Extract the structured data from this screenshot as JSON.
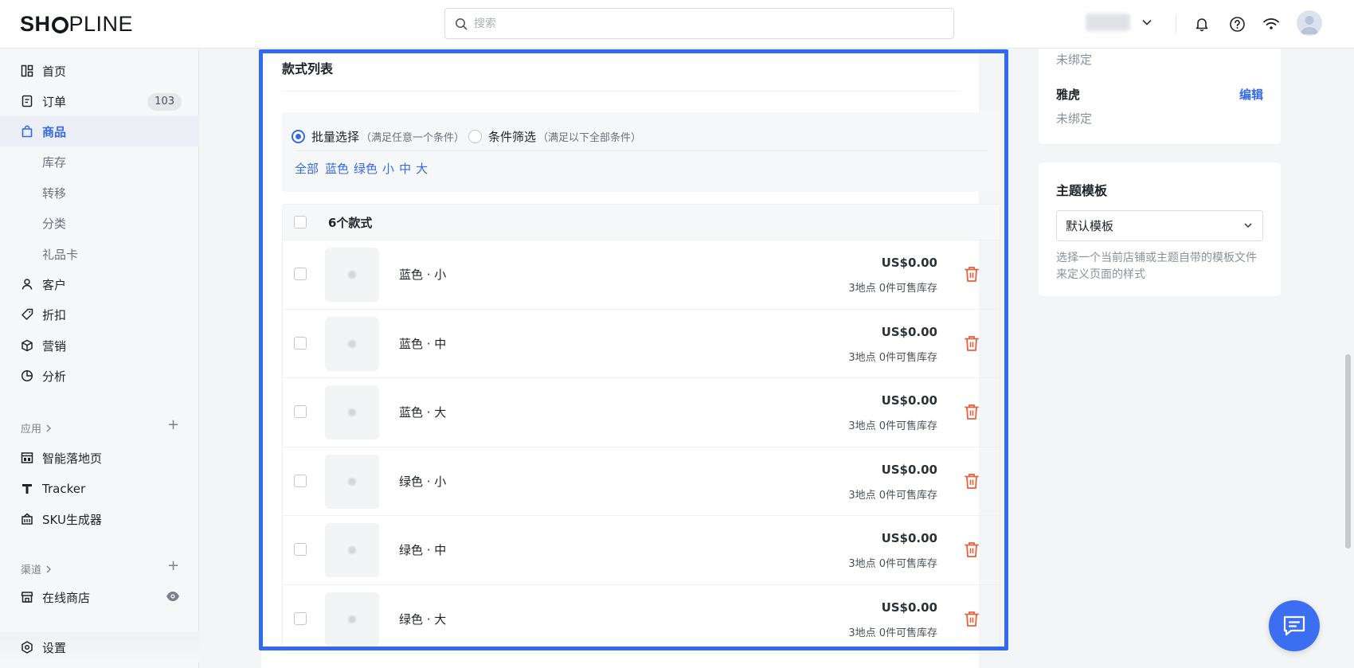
{
  "header": {
    "logo_left": "SH",
    "logo_right": "PLINE",
    "search_placeholder": "搜索"
  },
  "sidebar": {
    "items": [
      {
        "label": "首页"
      },
      {
        "label": "订单",
        "badge": "103"
      },
      {
        "label": "商品"
      },
      {
        "label": "库存"
      },
      {
        "label": "转移"
      },
      {
        "label": "分类"
      },
      {
        "label": "礼品卡"
      },
      {
        "label": "客户"
      },
      {
        "label": "折扣"
      },
      {
        "label": "营销"
      },
      {
        "label": "分析"
      }
    ],
    "apps_section": "应用",
    "apps": [
      {
        "label": "智能落地页"
      },
      {
        "label": "Tracker"
      },
      {
        "label": "SKU生成器"
      }
    ],
    "channels_section": "渠道",
    "channels": [
      {
        "label": "在线商店"
      }
    ],
    "settings": "设置"
  },
  "variants": {
    "title": "款式列表",
    "mode_batch": "批量选择",
    "mode_batch_hint": "（满足任意一个条件）",
    "mode_filter": "条件筛选",
    "mode_filter_hint": "（满足以下全部条件）",
    "chips": [
      "全部",
      "蓝色",
      "绿色",
      "小",
      "中",
      "大"
    ],
    "count_label": "6个款式",
    "rows": [
      {
        "name": "蓝色 · 小",
        "price": "US$0.00",
        "stock": "3地点 0件可售库存"
      },
      {
        "name": "蓝色 · 中",
        "price": "US$0.00",
        "stock": "3地点 0件可售库存"
      },
      {
        "name": "蓝色 · 大",
        "price": "US$0.00",
        "stock": "3地点 0件可售库存"
      },
      {
        "name": "绿色 · 小",
        "price": "US$0.00",
        "stock": "3地点 0件可售库存"
      },
      {
        "name": "绿色 · 中",
        "price": "US$0.00",
        "stock": "3地点 0件可售库存"
      },
      {
        "name": "绿色 · 大",
        "price": "US$0.00",
        "stock": "3地点 0件可售库存"
      }
    ]
  },
  "right": {
    "unbound_top": "未绑定",
    "yahoo_label": "雅虎",
    "edit_label": "编辑",
    "yahoo_status": "未绑定",
    "theme_title": "主题模板",
    "theme_value": "默认模板",
    "theme_help": "选择一个当前店铺或主题自带的模板文件来定义页面的样式"
  },
  "colors": {
    "accent": "#356ae6",
    "highlight_border": "#2f6af0",
    "delete_icon": "#e5603b"
  }
}
